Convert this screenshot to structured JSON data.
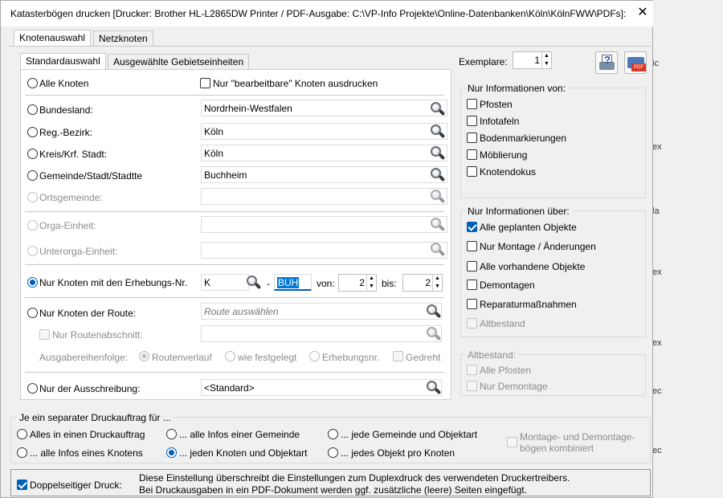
{
  "window": {
    "title": "Katasterbögen drucken [Drucker: Brother HL-L2865DW Printer / PDF-Ausgabe: C:\\VP-Info Projekte\\Online-Datenbanken\\Köln\\KölnFWW\\PDFs]:"
  },
  "tabs": {
    "outer": [
      "Knotenauswahl",
      "Netzknoten"
    ],
    "inner": [
      "Standardauswahl",
      "Ausgewählte Gebietseinheiten"
    ]
  },
  "selection": {
    "alle_knoten": "Alle Knoten",
    "nur_bearbeitbare": "Nur \"bearbeitbare\" Knoten ausdrucken",
    "bundesland": {
      "label": "Bundesland:",
      "value": "Nordrhein-Westfalen"
    },
    "regbezirk": {
      "label": "Reg.-Bezirk:",
      "value": "Köln"
    },
    "kreis": {
      "label": "Kreis/Krf. Stadt:",
      "value": "Köln"
    },
    "gemeinde": {
      "label": "Gemeinde/Stadt/Stadtte",
      "value": "Buchheim"
    },
    "ortsgemeinde": {
      "label": "Ortsgemeinde:",
      "value": ""
    },
    "orga": {
      "label": "Orga-Einheit:",
      "value": ""
    },
    "unterorga": {
      "label": "Unterorga-Einheit:",
      "value": ""
    },
    "erhebung": {
      "label": "Nur Knoten mit den Erhebungs-Nr.",
      "prefix": "K",
      "dash": "-",
      "code": "BUH",
      "von_label": "von:",
      "von": "2",
      "bis_label": "bis:",
      "bis": "2"
    },
    "route": {
      "label": "Nur Knoten der Route:",
      "placeholder": "Route auswählen",
      "abschnitt": "Nur Routenabschnitt:",
      "reihenfolge": "Ausgabereihenfolge:",
      "opt1": "Routenverlauf",
      "opt2": "wie festgelegt",
      "opt3": "Erhebungsnr.",
      "gedreht": "Gedreht"
    },
    "ausschreibung": {
      "label": "Nur der Ausschreibung:",
      "value": "<Standard>"
    }
  },
  "exemplare": {
    "label": "Exemplare:",
    "value": "1"
  },
  "info_von": {
    "title": "Nur Informationen von:",
    "items": [
      "Pfosten",
      "Infotafeln",
      "Bodenmarkierungen",
      "Möblierung",
      "Knotendokus"
    ]
  },
  "info_ueber": {
    "title": "Nur Informationen über:",
    "items": [
      "Alle geplanten Objekte",
      "Nur Montage / Änderungen",
      "Alle vorhandene Objekte",
      "Demontagen",
      "Reparaturmaßnahmen",
      "Altbestand"
    ],
    "checked": 0
  },
  "altbestand": {
    "title": "Altbestand:",
    "items": [
      "Alle Pfosten",
      "Nur Demontage"
    ]
  },
  "druckauftrag": {
    "title": "Je ein separater Druckauftrag für ...",
    "opts": [
      "Alles in einen Druckauftrag",
      "... alle Infos einer Gemeinde",
      "... jede Gemeinde und Objektart",
      "... alle Infos eines Knotens",
      "... jeden Knoten und Objektart",
      "... jedes Objekt pro Knoten"
    ],
    "selected": 4,
    "kombiniert": "Montage- und Demontage-\nbögen kombiniert"
  },
  "duplex": {
    "label": "Doppelseitiger Druck:",
    "line1": "Diese Einstellung überschreibt die Einstellungen zum Duplexdruck des verwendeten Druckertreibers.",
    "line2": "Bei Druckausgaben in ein PDF-Dokument werden ggf. zusätzliche (leere) Seiten eingefügt."
  },
  "background": {
    "right_texts": [
      "ic",
      "ex",
      "la",
      "ex",
      "ex",
      "ec",
      "ec"
    ]
  },
  "icons": {
    "close": "close-icon",
    "search": "search-icon",
    "print_help": "print-help-icon",
    "pdf": "pdf-icon"
  },
  "colors": {
    "accent": "#005fb8"
  }
}
